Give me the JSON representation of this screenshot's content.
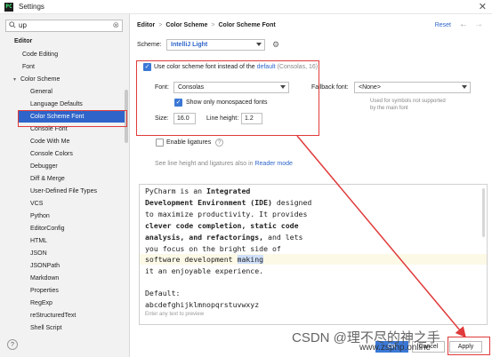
{
  "window": {
    "title": "Settings",
    "app_icon": "PC",
    "close": "✕"
  },
  "search": {
    "value": "up"
  },
  "sidebar": {
    "items": [
      {
        "label": "Editor"
      },
      {
        "label": "Code Editing"
      },
      {
        "label": "Font"
      },
      {
        "label": "Color Scheme"
      },
      {
        "label": "General"
      },
      {
        "label": "Language Defaults"
      },
      {
        "label": "Color Scheme Font"
      },
      {
        "label": "Console Font"
      },
      {
        "label": "Code With Me"
      },
      {
        "label": "Console Colors"
      },
      {
        "label": "Debugger"
      },
      {
        "label": "Diff & Merge"
      },
      {
        "label": "User-Defined File Types"
      },
      {
        "label": "VCS"
      },
      {
        "label": "Python"
      },
      {
        "label": "EditorConfig"
      },
      {
        "label": "HTML"
      },
      {
        "label": "JSON"
      },
      {
        "label": "JSONPath"
      },
      {
        "label": "Markdown"
      },
      {
        "label": "Properties"
      },
      {
        "label": "RegExp"
      },
      {
        "label": "reStructuredText"
      },
      {
        "label": "Shell Script"
      }
    ],
    "help": "?"
  },
  "header": {
    "crumb1": "Editor",
    "crumb2": "Color Scheme",
    "crumb3": "Color Scheme Font",
    "separator": ">",
    "reset": "Reset",
    "back": "←",
    "forward": "→"
  },
  "scheme": {
    "label": "Scheme:",
    "value": "IntelliJ Light"
  },
  "use_scheme_font": {
    "label": "Use color scheme font instead of the",
    "link": "default",
    "suffix": "(Consolas, 16)"
  },
  "font": {
    "label": "Font:",
    "value": "Consolas"
  },
  "monospaced": {
    "label": "Show only monospaced fonts"
  },
  "size": {
    "label": "Size:",
    "value": "16.0"
  },
  "line_height": {
    "label": "Line height:",
    "value": "1.2"
  },
  "fallback": {
    "label": "Fallback font:",
    "value": "<None>",
    "hint1": "Used for symbols not supported",
    "hint2": "by the main font"
  },
  "ligatures": {
    "label": "Enable ligatures"
  },
  "reader_mode": {
    "text": "See line height and ligatures also in",
    "link": "Reader mode"
  },
  "preview": {
    "l1a": "PyCharm is an ",
    "l1b": "Integrated",
    "l2a": "Development Environment (IDE)",
    "l2b": " designed",
    "l3": "to maximize productivity. It provides",
    "l4": "clever code completion, static code",
    "l5a": "analysis, and refactorings,",
    "l5b": " and lets",
    "l6": "you focus on the bright side of",
    "l7a": "software development ",
    "l7b": "making",
    "l8": "it an enjoyable experience.",
    "l9": "Default:",
    "l10": "abcdefghijklmnopqrstuvwxyz",
    "hint": "Enter any text to preview"
  },
  "buttons": {
    "ok": "OK",
    "cancel": "Cancel",
    "apply": "Apply"
  },
  "watermark": {
    "csdn": "CSDN @理不尽的神之手",
    "site": "www.zsphp.online"
  },
  "colors": {
    "accent": "#2f65ca",
    "annotation": "#e03a3a",
    "selected": "#2f65ca"
  }
}
